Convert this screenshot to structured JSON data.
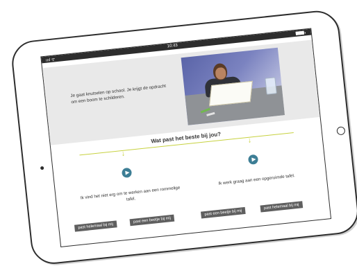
{
  "status_bar": {
    "signal": "ıııl ᯤ",
    "time": "10:43"
  },
  "scenario": {
    "text": "Je gaat knutselen op school. Je krijgt de opdracht om een boom te schilderen."
  },
  "question": "Wat past het beste bij jou?",
  "choices": [
    {
      "text": "Ik vind het niet erg om te werken aan een rommelige tafel.",
      "buttons": [
        "past helemaal bij mij",
        "past een beetje bij mij"
      ]
    },
    {
      "text": "Ik werk graag aan een opgeruimde tafel.",
      "buttons": [
        "past een beetje bij mij",
        "past helemaal bij mij"
      ]
    }
  ],
  "colors": {
    "accent_line": "#c6d13d",
    "play_button": "#3d7e95",
    "button_bg": "#5f5f5f"
  }
}
